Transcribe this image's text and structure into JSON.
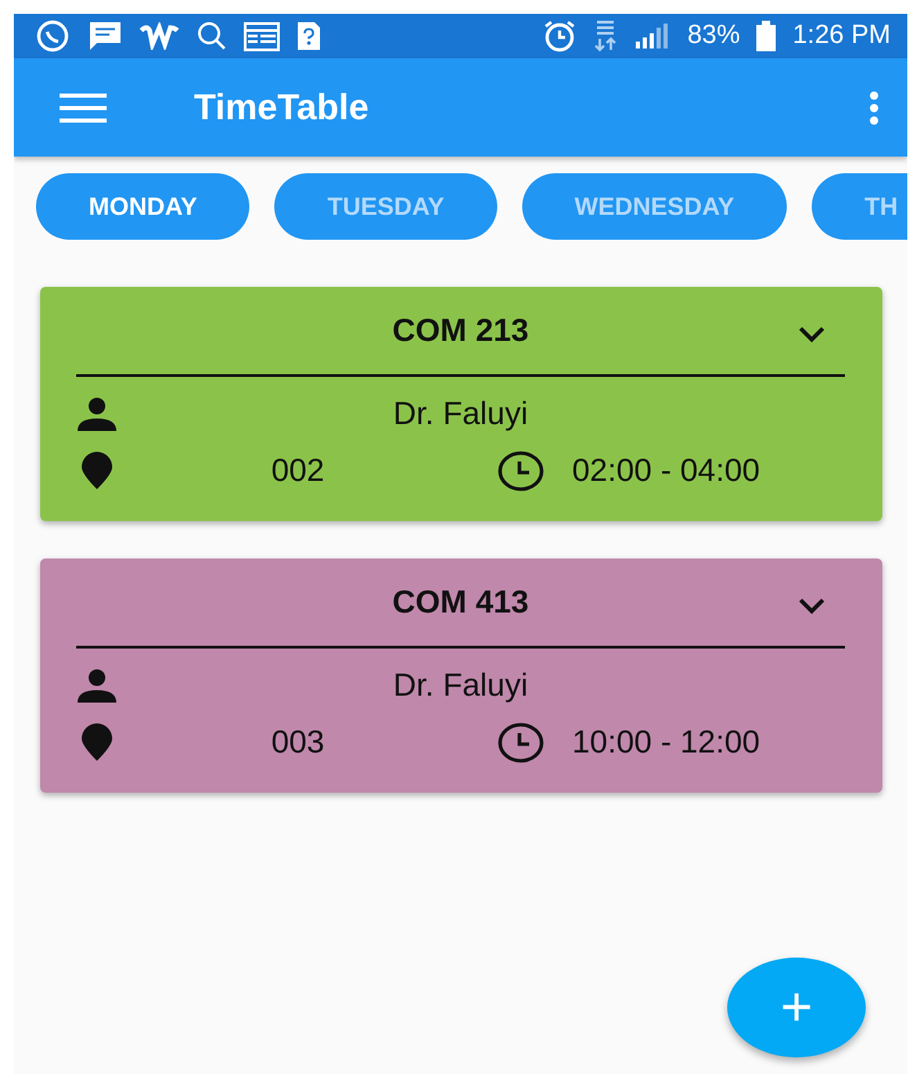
{
  "status_bar": {
    "battery": "83%",
    "time": "1:26 PM"
  },
  "app_bar": {
    "title": "TimeTable"
  },
  "days": [
    {
      "label": "MONDAY",
      "selected": true
    },
    {
      "label": "TUESDAY",
      "selected": false
    },
    {
      "label": "WEDNESDAY",
      "selected": false
    },
    {
      "label": "TH",
      "selected": false
    }
  ],
  "classes": [
    {
      "course": "COM 213",
      "lecturer": "Dr. Faluyi",
      "room": "002",
      "time": "02:00 - 04:00",
      "color": "#8bc34a"
    },
    {
      "course": "COM 413",
      "lecturer": "Dr. Faluyi",
      "room": "003",
      "time": "10:00 - 12:00",
      "color": "#c088ab"
    }
  ],
  "fab": {
    "label": "+"
  }
}
